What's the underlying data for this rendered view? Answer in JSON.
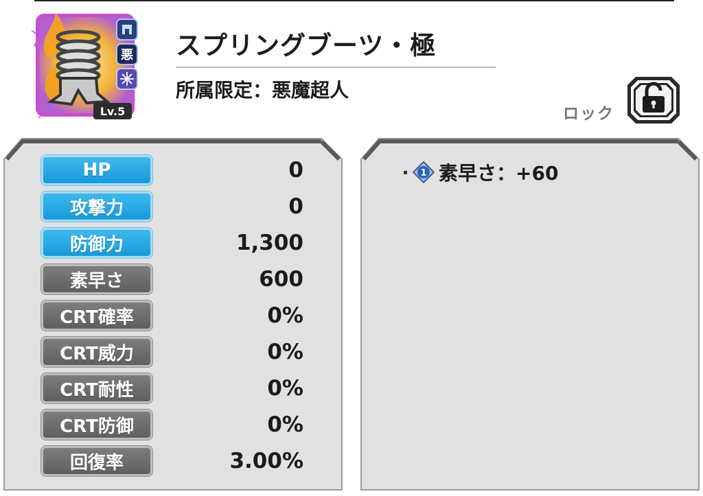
{
  "item": {
    "name": "スプリングブーツ・極",
    "affiliation": "所属限定：悪魔超人",
    "level": "Lv.5",
    "badges": {
      "equip_slot_icon": "boots-slot-icon",
      "faction": "悪",
      "attribute_icon": "ice-crystal-icon"
    },
    "icon": "spring-boots-icon"
  },
  "lock": {
    "label": "ロック",
    "icon": "unlocked-padlock-icon"
  },
  "stats": [
    {
      "label": "HP",
      "value": "0",
      "style": "blue"
    },
    {
      "label": "攻撃力",
      "value": "0",
      "style": "blue"
    },
    {
      "label": "防御力",
      "value": "1,300",
      "style": "blue"
    },
    {
      "label": "素早さ",
      "value": "600",
      "style": "gray"
    },
    {
      "label": "CRT確率",
      "value": "0%",
      "style": "gray"
    },
    {
      "label": "CRT威力",
      "value": "0%",
      "style": "gray"
    },
    {
      "label": "CRT耐性",
      "value": "0%",
      "style": "gray"
    },
    {
      "label": "CRT防御",
      "value": "0%",
      "style": "gray"
    },
    {
      "label": "回復率",
      "value": "3.00%",
      "style": "gray"
    }
  ],
  "bonus": {
    "badge_number": "1",
    "text": "素早さ：+60"
  },
  "colors": {
    "stat_blue": "#1fa3e0",
    "stat_gray": "#6b6b6b",
    "panel_bg": "#e3e3e3",
    "frame_pink": "#d84fd8"
  }
}
